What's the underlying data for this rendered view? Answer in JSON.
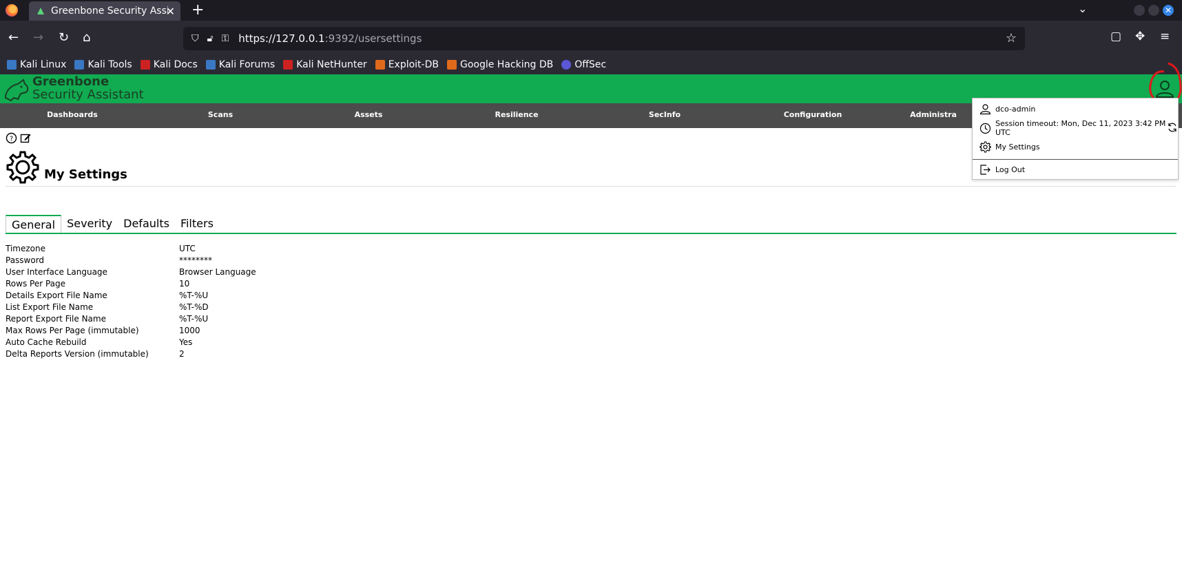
{
  "browser": {
    "tab_title": "Greenbone Security Assis",
    "url_host": "https://127.0.0.1",
    "url_path": ":9392/usersettings",
    "bookmarks": [
      {
        "label": "Kali Linux",
        "color": "#3a78c4"
      },
      {
        "label": "Kali Tools",
        "color": "#3a78c4"
      },
      {
        "label": "Kali Docs",
        "color": "#cc2222"
      },
      {
        "label": "Kali Forums",
        "color": "#3a78c4"
      },
      {
        "label": "Kali NetHunter",
        "color": "#cc2222"
      },
      {
        "label": "Exploit-DB",
        "color": "#e06a1c"
      },
      {
        "label": "Google Hacking DB",
        "color": "#e06a1c"
      },
      {
        "label": "OffSec",
        "color": "#5b57d6"
      }
    ]
  },
  "app": {
    "brand_line1": "Greenbone",
    "brand_line2": "Security Assistant",
    "accent": "#11ab51"
  },
  "menu": {
    "items": [
      "Dashboards",
      "Scans",
      "Assets",
      "Resilience",
      "SecInfo",
      "Configuration",
      "Administra"
    ]
  },
  "page": {
    "title": "My Settings",
    "tabs": [
      "General",
      "Severity",
      "Defaults",
      "Filters"
    ],
    "active_tab": "General",
    "settings": [
      {
        "label": "Timezone",
        "value": "UTC"
      },
      {
        "label": "Password",
        "value": "********"
      },
      {
        "label": "User Interface Language",
        "value": "Browser Language"
      },
      {
        "label": "Rows Per Page",
        "value": "10"
      },
      {
        "label": "Details Export File Name",
        "value": "%T-%U"
      },
      {
        "label": "List Export File Name",
        "value": "%T-%D"
      },
      {
        "label": "Report Export File Name",
        "value": "%T-%U"
      },
      {
        "label": "Max Rows Per Page (immutable)",
        "value": "1000"
      },
      {
        "label": "Auto Cache Rebuild",
        "value": "Yes"
      },
      {
        "label": "Delta Reports Version (immutable)",
        "value": "2"
      }
    ]
  },
  "user_menu": {
    "username": "dco-admin",
    "session_line1": "Session timeout: Mon, Dec 11, 2023 3:42 PM",
    "session_line2": "UTC",
    "my_settings": "My Settings",
    "logout": "Log Out"
  }
}
